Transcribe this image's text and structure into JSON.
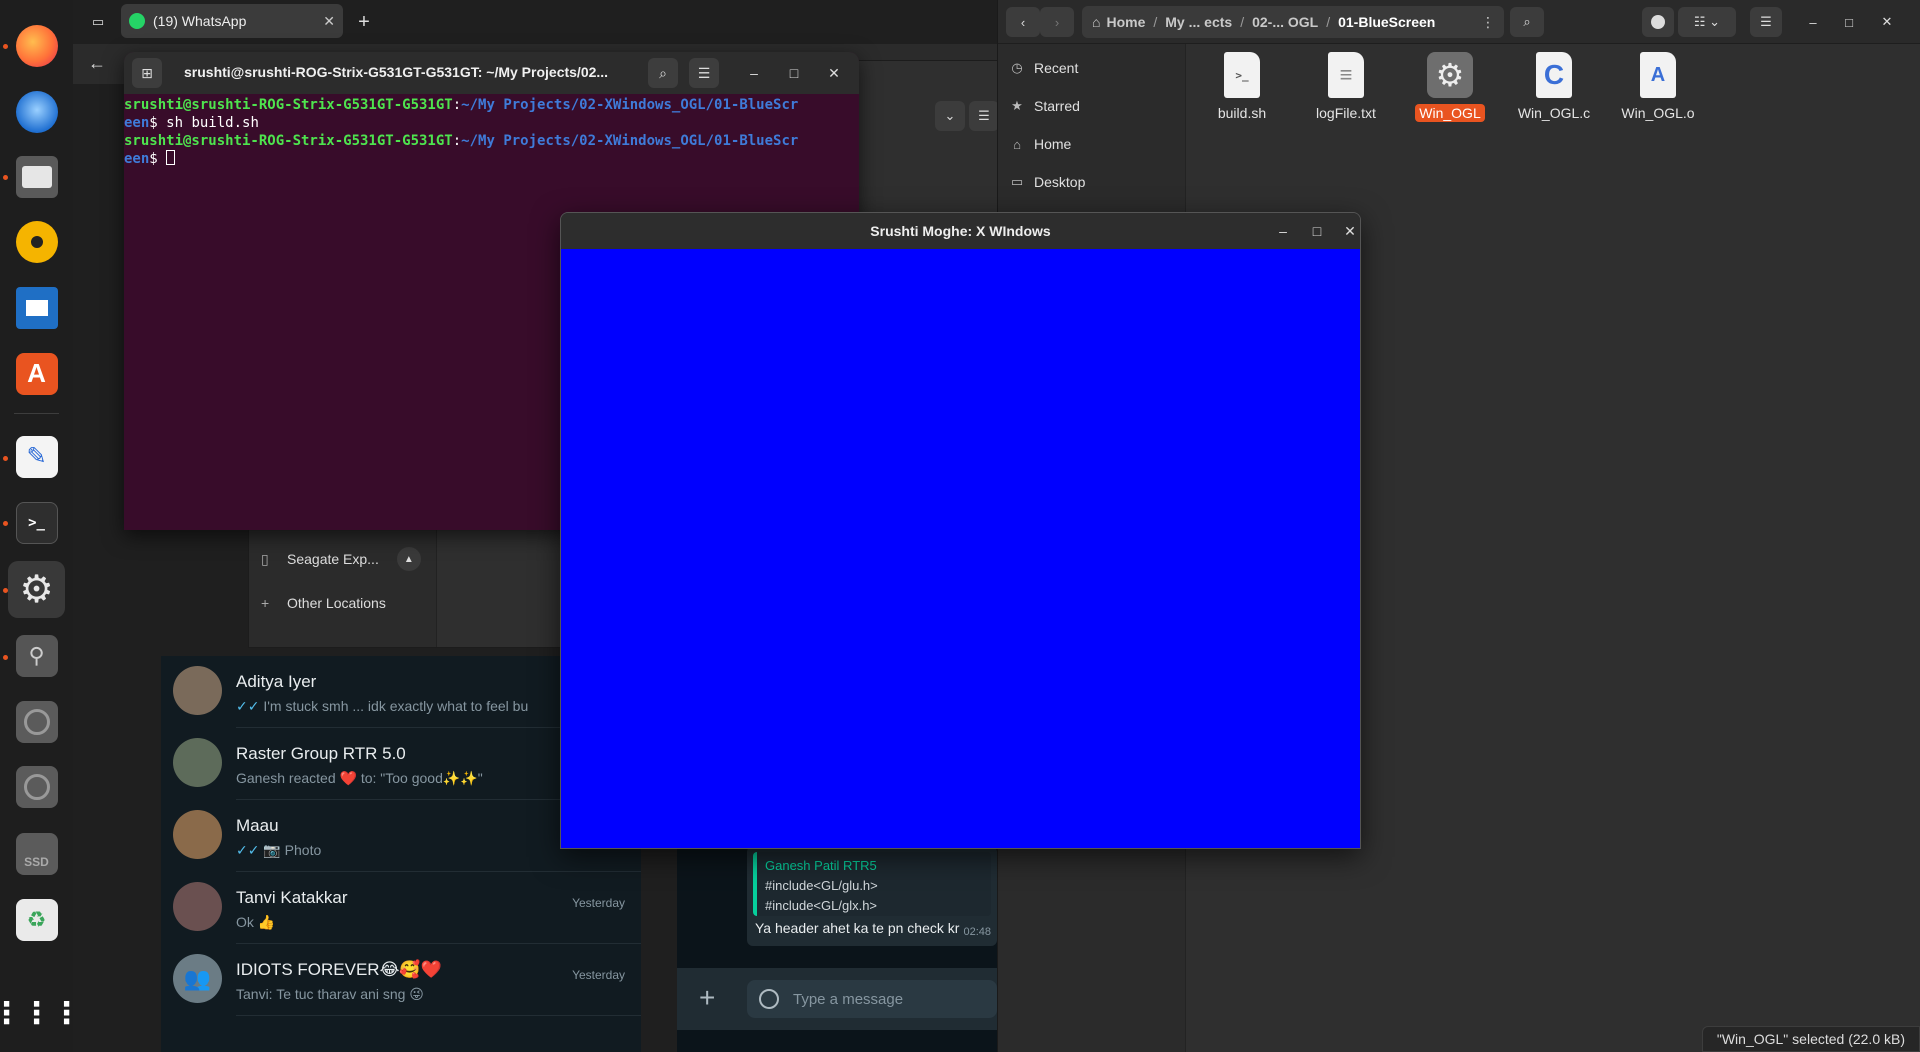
{
  "browser": {
    "tab_title": "(19) WhatsApp",
    "tab_close": "✕",
    "new_tab": "+"
  },
  "whatsapp": {
    "chats": [
      {
        "name": "Aditya Iyer",
        "preview": "I'm stuck smh ... idk exactly what to feel bu",
        "ticks": "✓✓",
        "time": ""
      },
      {
        "name": "Raster Group RTR 5.0",
        "preview": "Ganesh reacted ❤️ to: \"Too good✨✨\"",
        "ticks": "",
        "time": ""
      },
      {
        "name": "Maau",
        "preview": "📷 Photo",
        "ticks": "✓✓",
        "time": ""
      },
      {
        "name": "Tanvi Katakkar",
        "preview": "Ok 👍",
        "ticks": "",
        "time": "Yesterday"
      },
      {
        "name": "IDIOTS FOREVER😂🥰❤️",
        "preview": "Tanvi: Te tuc tharav ani sng 😜",
        "ticks": "",
        "time": "Yesterday"
      }
    ],
    "quote_author": "Ganesh Patil RTR5",
    "quote_line1": "#include<GL/glu.h>",
    "quote_line2": "#include<GL/glx.h>",
    "message": "Ya header ahet ka te pn check kr",
    "message_time": "02:48",
    "composer_placeholder": "Type a message"
  },
  "files_back": {
    "device": "Seagate Exp...",
    "other_locations": "Other Locations"
  },
  "terminal": {
    "title": "srushti@srushti-ROG-Strix-G531GT-G531GT: ~/My Projects/02...",
    "user1": "srushti@srushti-ROG-Strix-G531GT-G531GT",
    "path1a": "~/My Projects/02-XWindows_OGL/01-BlueScr",
    "path1b": "een",
    "cmd1": "sh build.sh",
    "user2": "srushti@srushti-ROG-Strix-G531GT-G531GT",
    "path2a": "~/My Projects/02-XWindows_OGL/01-BlueScr",
    "path2b": "een"
  },
  "xwindow": {
    "title": "Srushti Moghe: X WIndows",
    "canvas_color": "#0000ff"
  },
  "files": {
    "path": [
      "Home",
      "My ... ects",
      "02-... OGL",
      "01-BlueScreen"
    ],
    "sidebar": [
      "Recent",
      "Starred",
      "Home",
      "Desktop"
    ],
    "items": [
      {
        "name": "build.sh",
        "glyph": ">_"
      },
      {
        "name": "logFile.txt",
        "glyph": "≡"
      },
      {
        "name": "Win_OGL",
        "glyph": "⚙"
      },
      {
        "name": "Win_OGL.c",
        "glyph": "C"
      },
      {
        "name": "Win_OGL.o",
        "glyph": "A"
      }
    ],
    "status": "\"Win_OGL\" selected  (22.0 kB)"
  },
  "colors": {
    "accent": "#e95420",
    "terminal_bg": "#380c2a",
    "blue_window": "#0000ff"
  }
}
